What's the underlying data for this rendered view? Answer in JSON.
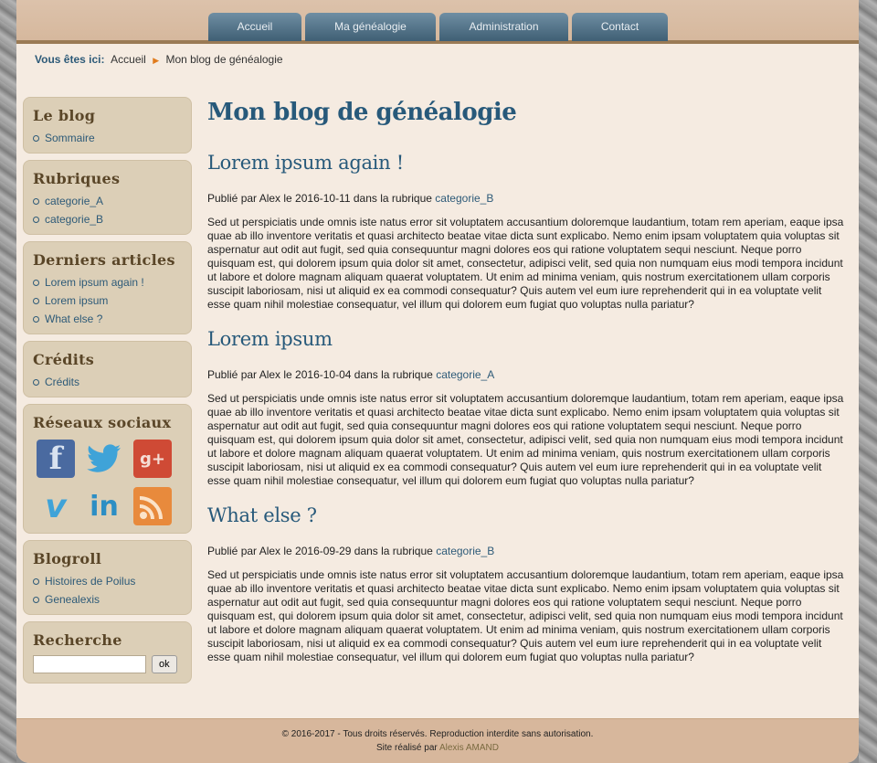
{
  "nav": [
    {
      "label": "Accueil"
    },
    {
      "label": "Ma généalogie"
    },
    {
      "label": "Administration"
    },
    {
      "label": "Contact"
    }
  ],
  "breadcrumb": {
    "prefix": "Vous êtes ici:",
    "home": "Accueil",
    "current": "Mon blog de généalogie"
  },
  "sidebar": {
    "blog": {
      "title": "Le blog",
      "items": [
        "Sommaire"
      ]
    },
    "rubriques": {
      "title": "Rubriques",
      "items": [
        "categorie_A",
        "categorie_B"
      ]
    },
    "derniers": {
      "title": "Derniers articles",
      "items": [
        "Lorem ipsum again !",
        "Lorem ipsum",
        "What else ?"
      ]
    },
    "credits": {
      "title": "Crédits",
      "items": [
        "Crédits"
      ]
    },
    "social": {
      "title": "Réseaux sociaux",
      "icons": [
        "facebook-icon",
        "twitter-icon",
        "google-plus-icon",
        "vimeo-icon",
        "linkedin-icon",
        "rss-icon"
      ]
    },
    "blogroll": {
      "title": "Blogroll",
      "items": [
        "Histoires de Poilus",
        "Genealexis"
      ]
    },
    "recherche": {
      "title": "Recherche",
      "button": "ok",
      "placeholder": ""
    }
  },
  "main": {
    "title": "Mon blog de généalogie",
    "articles": [
      {
        "title": "Lorem ipsum again !",
        "meta_prefix": "Publié par Alex le 2016-10-11 dans la rubrique",
        "category": "categorie_B",
        "body": "Sed ut perspiciatis unde omnis iste natus error sit voluptatem accusantium doloremque laudantium, totam rem aperiam, eaque ipsa quae ab illo inventore veritatis et quasi architecto beatae vitae dicta sunt explicabo. Nemo enim ipsam voluptatem quia voluptas sit aspernatur aut odit aut fugit, sed quia consequuntur magni dolores eos qui ratione voluptatem sequi nesciunt. Neque porro quisquam est, qui dolorem ipsum quia dolor sit amet, consectetur, adipisci velit, sed quia non numquam eius modi tempora incidunt ut labore et dolore magnam aliquam quaerat voluptatem. Ut enim ad minima veniam, quis nostrum exercitationem ullam corporis suscipit laboriosam, nisi ut aliquid ex ea commodi consequatur? Quis autem vel eum iure reprehenderit qui in ea voluptate velit esse quam nihil molestiae consequatur, vel illum qui dolorem eum fugiat quo voluptas nulla pariatur?"
      },
      {
        "title": "Lorem ipsum",
        "meta_prefix": "Publié par Alex le 2016-10-04 dans la rubrique",
        "category": "categorie_A",
        "body": "Sed ut perspiciatis unde omnis iste natus error sit voluptatem accusantium doloremque laudantium, totam rem aperiam, eaque ipsa quae ab illo inventore veritatis et quasi architecto beatae vitae dicta sunt explicabo. Nemo enim ipsam voluptatem quia voluptas sit aspernatur aut odit aut fugit, sed quia consequuntur magni dolores eos qui ratione voluptatem sequi nesciunt. Neque porro quisquam est, qui dolorem ipsum quia dolor sit amet, consectetur, adipisci velit, sed quia non numquam eius modi tempora incidunt ut labore et dolore magnam aliquam quaerat voluptatem. Ut enim ad minima veniam, quis nostrum exercitationem ullam corporis suscipit laboriosam, nisi ut aliquid ex ea commodi consequatur? Quis autem vel eum iure reprehenderit qui in ea voluptate velit esse quam nihil molestiae consequatur, vel illum qui dolorem eum fugiat quo voluptas nulla pariatur?"
      },
      {
        "title": "What else ?",
        "meta_prefix": "Publié par Alex le 2016-09-29 dans la rubrique",
        "category": "categorie_B",
        "body": "Sed ut perspiciatis unde omnis iste natus error sit voluptatem accusantium doloremque laudantium, totam rem aperiam, eaque ipsa quae ab illo inventore veritatis et quasi architecto beatae vitae dicta sunt explicabo. Nemo enim ipsam voluptatem quia voluptas sit aspernatur aut odit aut fugit, sed quia consequuntur magni dolores eos qui ratione voluptatem sequi nesciunt. Neque porro quisquam est, qui dolorem ipsum quia dolor sit amet, consectetur, adipisci velit, sed quia non numquam eius modi tempora incidunt ut labore et dolore magnam aliquam quaerat voluptatem. Ut enim ad minima veniam, quis nostrum exercitationem ullam corporis suscipit laboriosam, nisi ut aliquid ex ea commodi consequatur? Quis autem vel eum iure reprehenderit qui in ea voluptate velit esse quam nihil molestiae consequatur, vel illum qui dolorem eum fugiat quo voluptas nulla pariatur?"
      }
    ]
  },
  "footer": {
    "copyright": "© 2016-2017 - Tous droits réservés. Reproduction interdite sans autorisation.",
    "credit_prefix": "Site réalisé par",
    "author": "Alexis AMAND"
  },
  "colors": {
    "accent": "#27597a",
    "sidebar_block": "#dccfb7",
    "page_bg": "#f5ebe1",
    "header": "#d6b89d"
  }
}
